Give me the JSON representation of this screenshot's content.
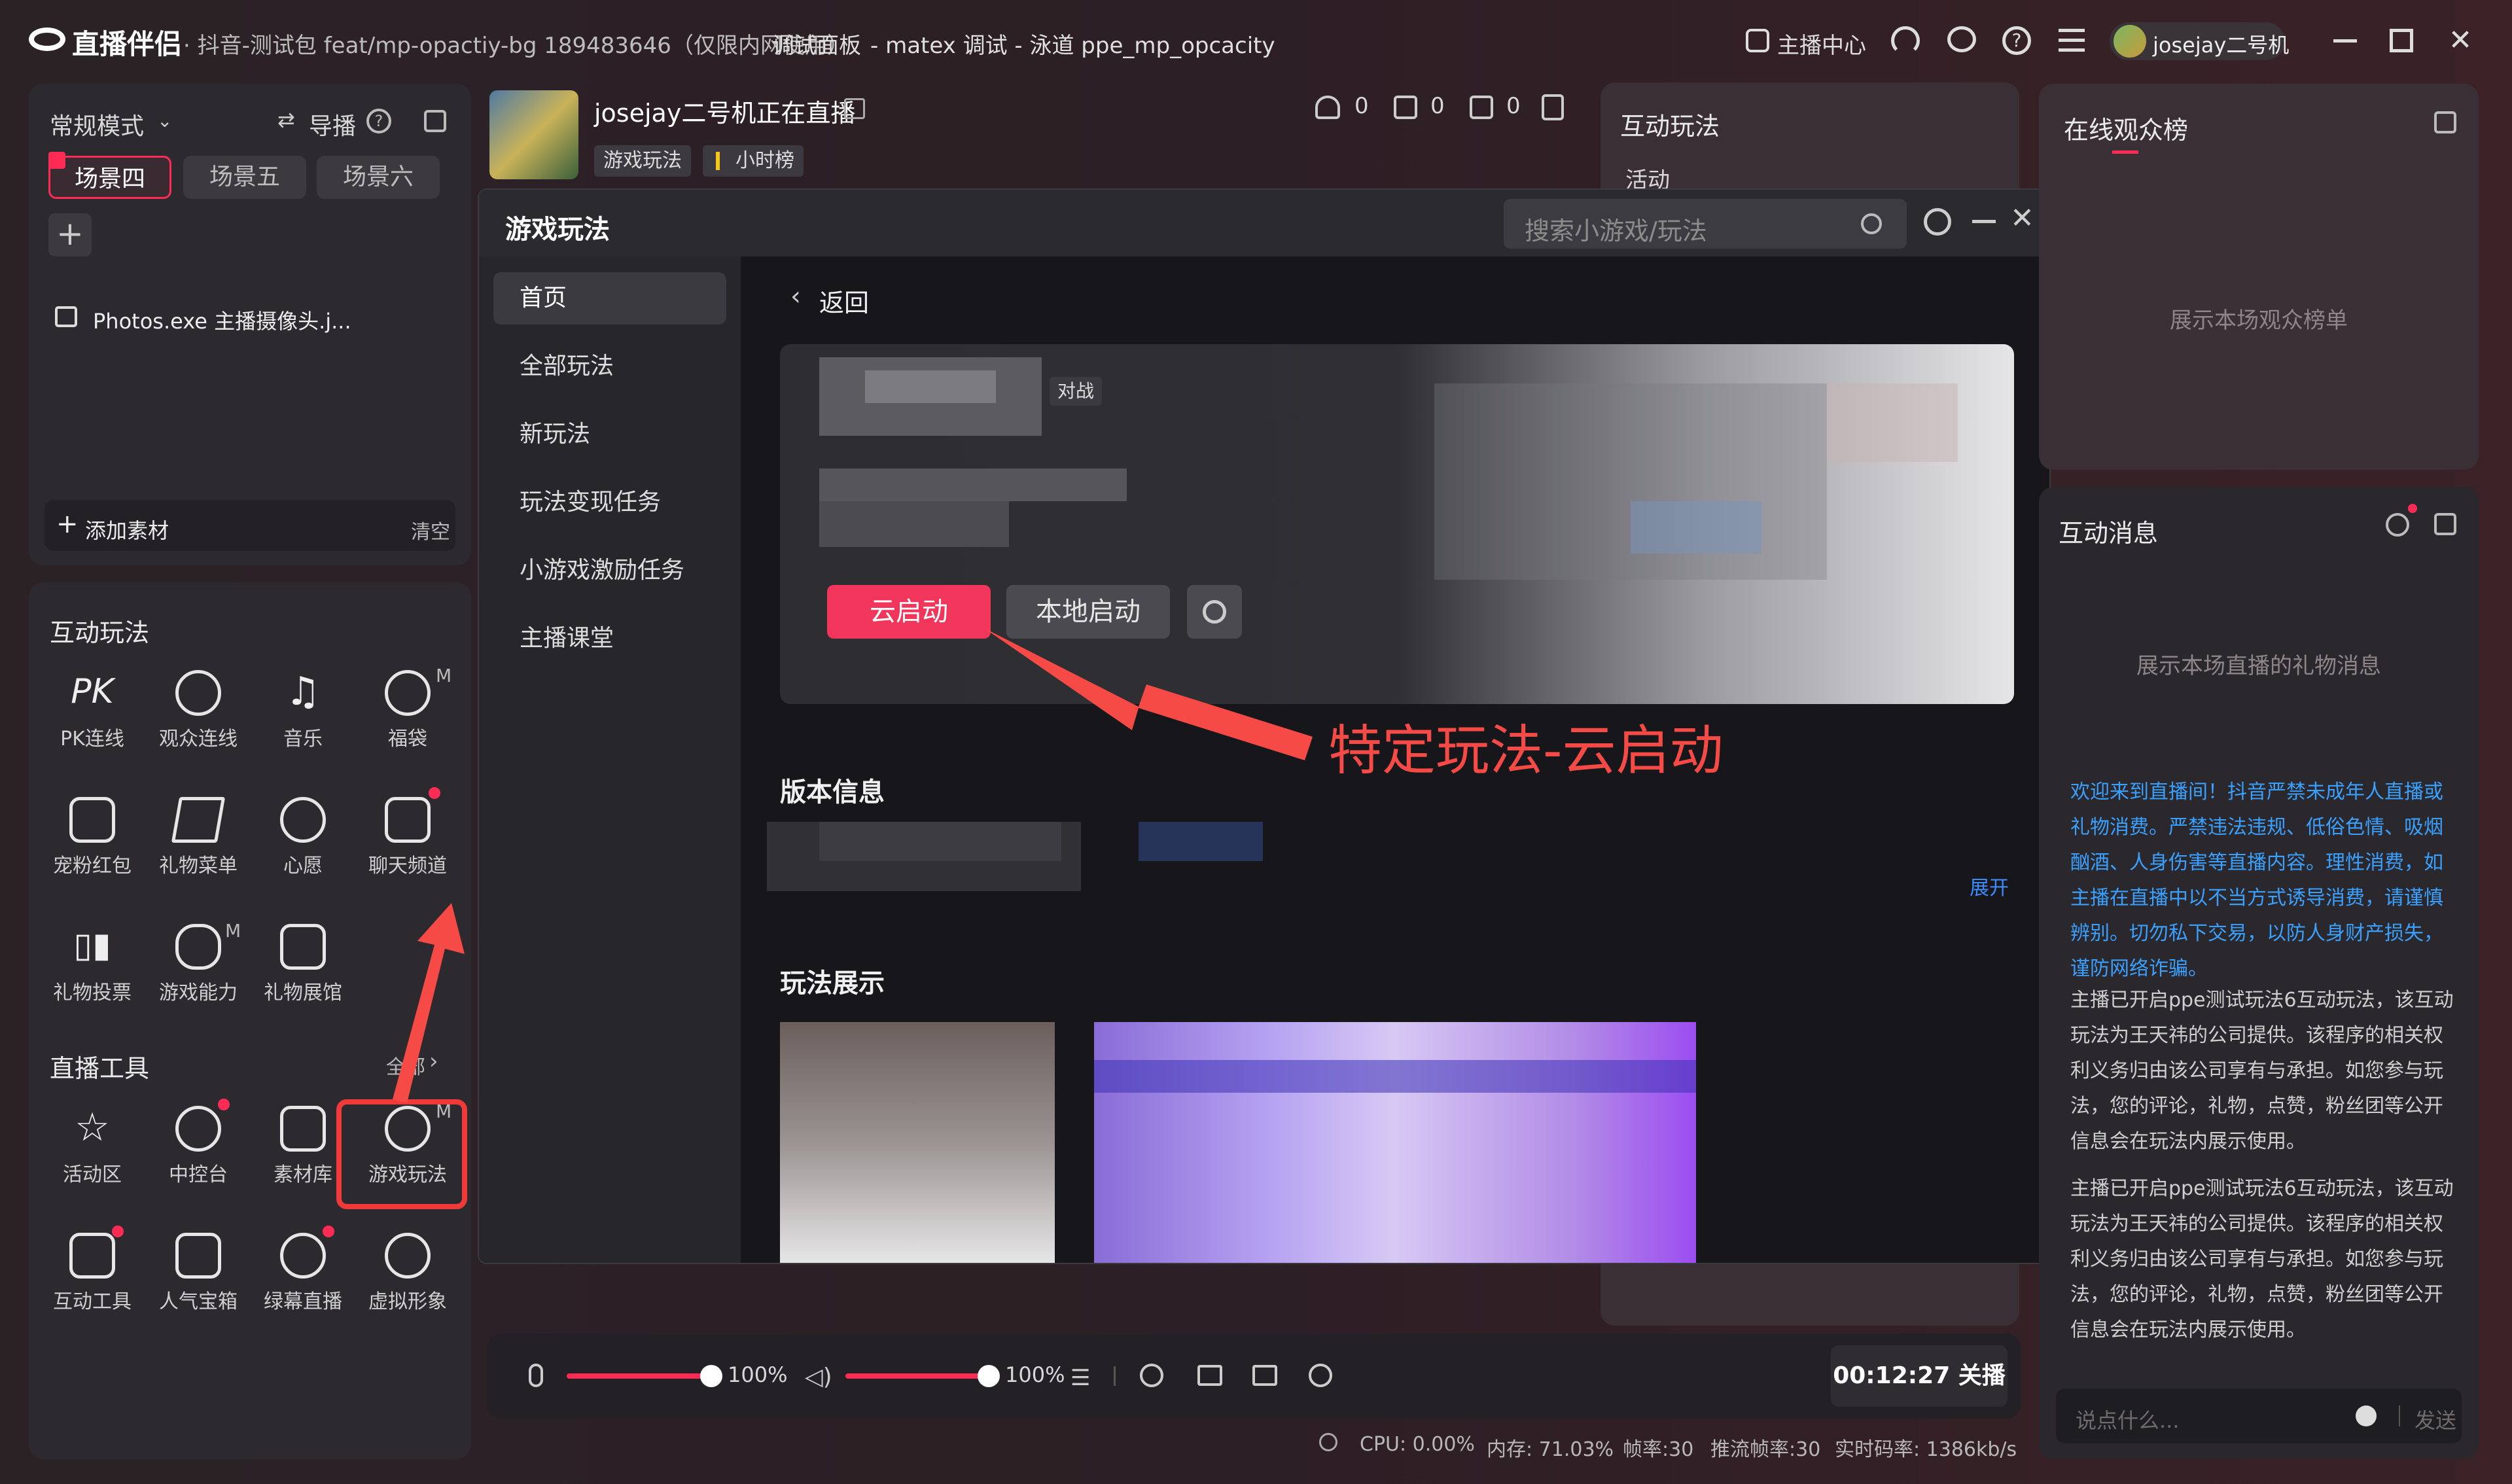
{
  "titlebar": {
    "app_name": "直播伴侣",
    "info_text": "· 抖音-测试包 feat/mp-opactiy-bg 189483646（仅限内网使用）",
    "debug_panel": "调试面板",
    "matex": "- matex 调试 - 泳道 ppe_mp_opcacity",
    "anchor_center": "主播中心",
    "username": "josejay二号机"
  },
  "left_top": {
    "mode": "常规模式",
    "guide": "导播",
    "scenes": [
      "场景四",
      "场景五",
      "场景六"
    ],
    "source_item": "Photos.exe 主播摄像头.j...",
    "add_material": "添加素材",
    "clear": "清空"
  },
  "interactive": {
    "title": "互动玩法",
    "items": [
      "PK连线",
      "观众连线",
      "音乐",
      "福袋",
      "宠粉红包",
      "礼物菜单",
      "心愿",
      "聊天频道",
      "礼物投票",
      "游戏能力",
      "礼物展馆"
    ],
    "m_mark": "M"
  },
  "tools": {
    "title": "直播工具",
    "all": "全部",
    "items": [
      "活动区",
      "中控台",
      "素材库",
      "游戏玩法",
      "互动工具",
      "人气宝箱",
      "绿幕直播",
      "虚拟形象"
    ]
  },
  "stream_info": {
    "title": "josejay二号机正在直播",
    "tag1": "游戏玩法",
    "tag2": "小时榜",
    "stats": [
      "0",
      "0",
      "0"
    ]
  },
  "mid_panel": {
    "title": "互动玩法",
    "sub": "活动"
  },
  "dialog": {
    "title": "游戏玩法",
    "search_placeholder": "搜索小游戏/玩法",
    "nav": [
      "首页",
      "全部玩法",
      "新玩法",
      "玩法变现任务",
      "小游戏激励任务",
      "主播课堂"
    ],
    "back": "返回",
    "badge": "对战",
    "cloud_start": "云启动",
    "local_start": "本地启动",
    "version_title": "版本信息",
    "expand": "展开",
    "showcase_title": "玩法展示"
  },
  "annotation": {
    "text": "特定玩法-云启动",
    "color": "#f54a45"
  },
  "audience": {
    "title": "在线观众榜",
    "empty": "展示本场观众榜单"
  },
  "messages": {
    "title": "互动消息",
    "empty": "展示本场直播的礼物消息",
    "notice": "欢迎来到直播间！抖音严禁未成年人直播或礼物消费。严禁违法违规、低俗色情、吸烟酗酒、人身伤害等直播内容。理性消费，如主播在直播中以不当方式诱导消费，请谨慎辨别。切勿私下交易，以防人身财产损失，谨防网络诈骗。",
    "msg1": "主播已开启ppe测试玩法6互动玩法，该互动玩法为王天祎的公司提供。该程序的相关权利义务归由该公司享有与承担。如您参与玩法，您的评论，礼物，点赞，粉丝团等公开信息会在玩法内展示使用。",
    "msg2": "主播已开启ppe测试玩法6互动玩法，该互动玩法为王天祎的公司提供。该程序的相关权利义务归由该公司享有与承担。如您参与玩法，您的评论，礼物，点赞，粉丝团等公开信息会在玩法内展示使用。",
    "input_placeholder": "说点什么...",
    "send": "发送"
  },
  "bottom": {
    "mic_volume": "100%",
    "speaker_volume": "100%",
    "mic_level": 1.0,
    "speaker_level": 1.0,
    "timer": "00:12:27 关播"
  },
  "status": {
    "cpu": "CPU: 0.00%",
    "mem": "内存: 71.03%",
    "fps": "帧率:30",
    "push_fps": "推流帧率:30",
    "bitrate": "实时码率: 1386kb/s"
  },
  "colors": {
    "accent": "#fe2c55",
    "link": "#3aa0ff"
  }
}
